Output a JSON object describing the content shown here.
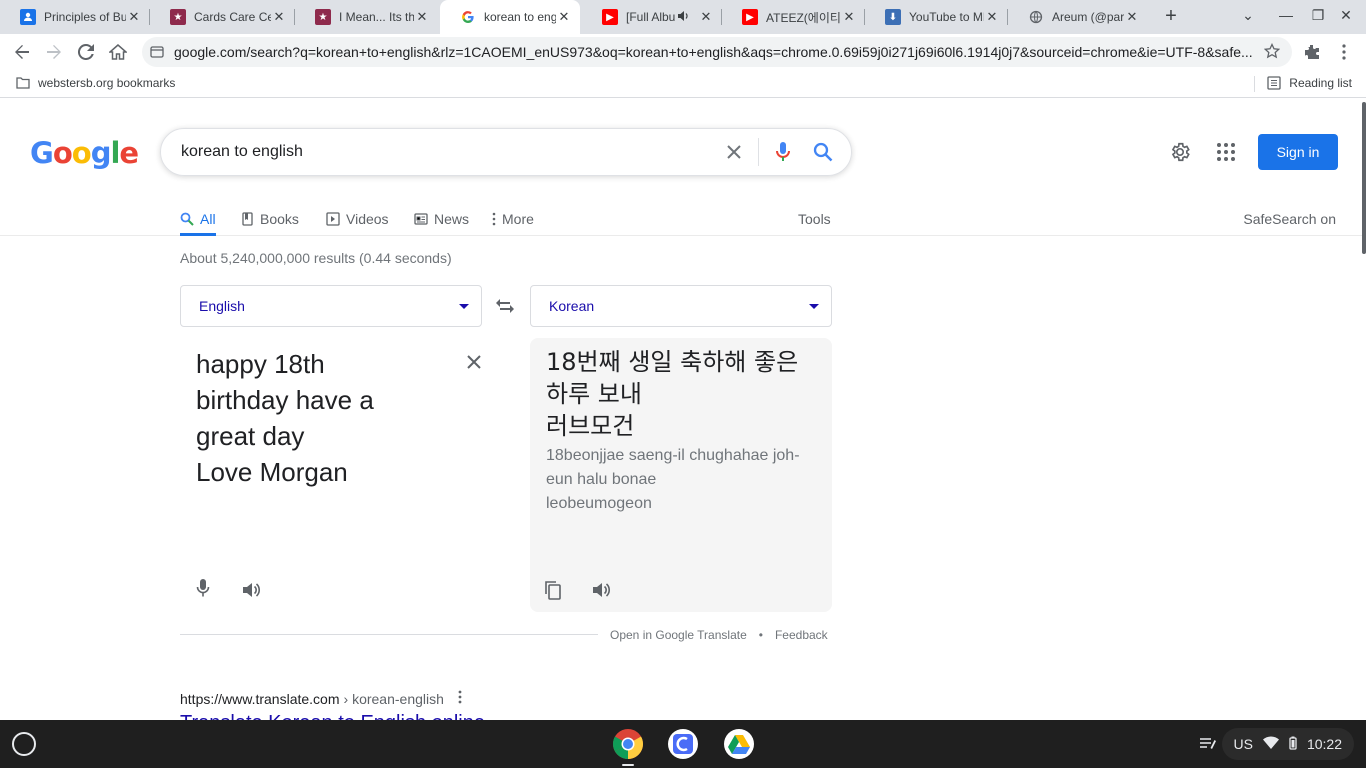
{
  "browser": {
    "tabs": [
      {
        "label": "Principles of Bu",
        "icon": "contact-icon",
        "color": "#1a73e8"
      },
      {
        "label": "Cards Care Cen",
        "icon": "avatar-icon",
        "color": "#8e2a4c"
      },
      {
        "label": "I Mean... Its the",
        "icon": "avatar-icon",
        "color": "#8e2a4c"
      },
      {
        "label": "korean to engl",
        "icon": "google-icon",
        "color": "#4285f4",
        "active": true
      },
      {
        "label": "[Full Album",
        "icon": "youtube-icon",
        "color": "#ff0000",
        "audio": true
      },
      {
        "label": "ATEEZ(에이티즈",
        "icon": "youtube-icon",
        "color": "#ff0000"
      },
      {
        "label": "YouTube to MP",
        "icon": "download-icon",
        "color": "#3c6fb5"
      },
      {
        "label": "Areum (@park",
        "icon": "globe-icon",
        "color": "#5f6368"
      }
    ],
    "url": "google.com/search?q=korean+to+english&rlz=1CAOEMI_enUS973&oq=korean+to+english&aqs=chrome.0.69i59j0i271j69i60l6.1914j0j7&sourceid=chrome&ie=UTF-8&safe...",
    "bookmarks": {
      "folder": "webstersb.org bookmarks",
      "reading_list": "Reading list"
    }
  },
  "search": {
    "query": "korean to english",
    "sign_in": "Sign in",
    "tabs": [
      "All",
      "Books",
      "Videos",
      "News",
      "More"
    ],
    "tools": "Tools",
    "safesearch": "SafeSearch on",
    "stats": "About 5,240,000,000 results (0.44 seconds)"
  },
  "translate": {
    "source_lang": "English",
    "target_lang": "Korean",
    "source_text": "happy 18th\nbirthday have a\ngreat day\nLove Morgan",
    "target_text": "18번째 생일 축하해 좋은\n하루 보내\n러브모건",
    "romanization": "18beonjjae saeng-il chughahae joh-\neun halu bonae\nleobeumogeon",
    "open_link": "Open in Google Translate",
    "dot": "•",
    "feedback": "Feedback"
  },
  "result": {
    "site": "https://www.translate.com",
    "path": "› korean-english",
    "title": "Translate Korean to English online"
  },
  "shelf": {
    "locale": "US",
    "time": "10:22"
  },
  "logo": {
    "text": "Google"
  }
}
